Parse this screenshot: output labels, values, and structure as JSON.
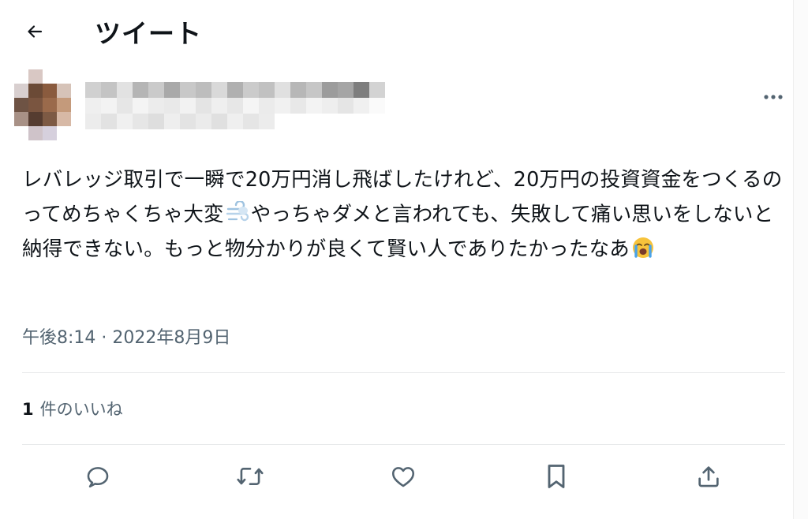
{
  "header": {
    "title": "ツイート",
    "back_icon": "arrow-left-icon"
  },
  "tweet": {
    "text_segments": [
      "レバレッジ取引で一瞬で20万円消し飛ばしたけれど、20万円の投資資金をつくるのってめちゃくちゃ大変",
      "やっちゃダメと言われても、失敗して痛い思いをしないと納得できない。もっと物分かりが良くて賢い人でありたかったなあ"
    ],
    "emojis": [
      "dashing-away-emoji",
      "loudly-crying-face-emoji"
    ],
    "timestamp": "午後8:14 · 2022年8月9日"
  },
  "stats": {
    "likes_count": "1",
    "likes_label": "件のいいね"
  },
  "actions": [
    "reply-icon",
    "retweet-icon",
    "like-icon",
    "bookmark-icon",
    "share-icon"
  ],
  "colors": {
    "text": "#0f1419",
    "secondary": "#536471",
    "divider": "#e7e9ea"
  }
}
